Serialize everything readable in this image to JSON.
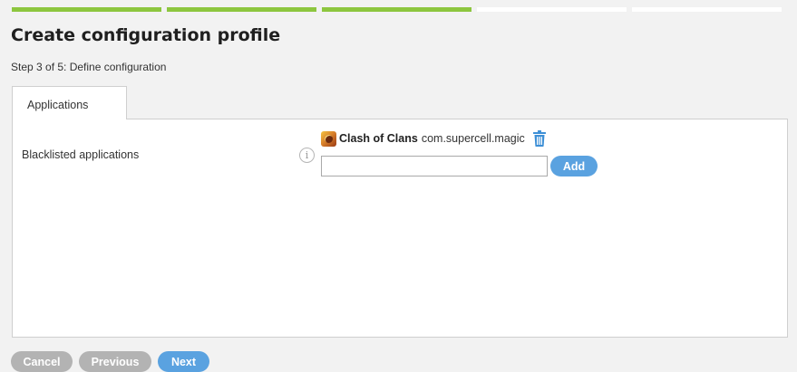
{
  "progress": {
    "total_steps": 5,
    "completed_steps": 3,
    "done_color": "#8dc63f"
  },
  "header": {
    "title": "Create configuration profile",
    "subtitle": "Step 3 of 5: Define configuration"
  },
  "tabs": [
    {
      "label": "Applications",
      "active": true
    }
  ],
  "blacklist": {
    "label": "Blacklisted applications",
    "info_icon": "i",
    "apps": [
      {
        "name": "Clash of Clans",
        "package": "com.supercell.magic",
        "icon": "clash-of-clans-app-icon"
      }
    ],
    "input": {
      "value": "",
      "placeholder": ""
    },
    "add_label": "Add"
  },
  "footer": {
    "cancel_label": "Cancel",
    "previous_label": "Previous",
    "next_label": "Next"
  },
  "colors": {
    "primary_button": "#5aa2e0",
    "secondary_button": "#b3b3b3",
    "trash_icon": "#3d8fd6"
  }
}
